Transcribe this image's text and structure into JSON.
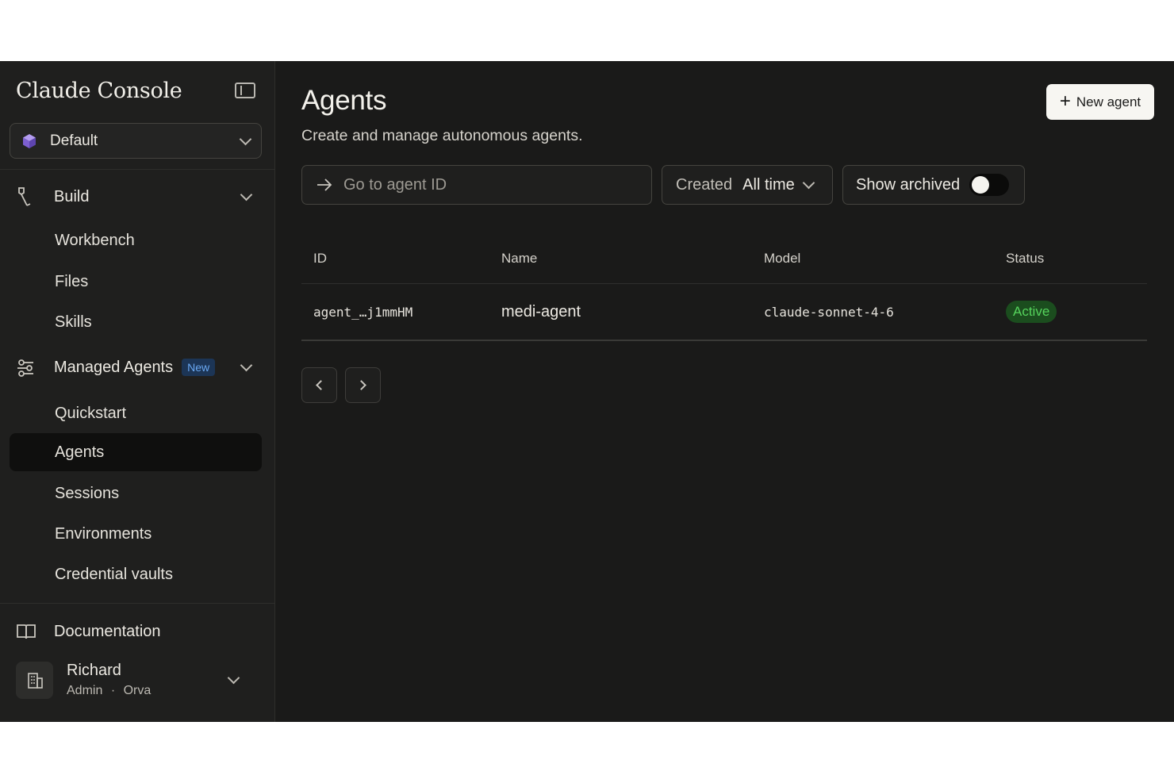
{
  "app": {
    "brand": "Claude Console"
  },
  "workspace": {
    "label": "Default"
  },
  "sidebar": {
    "build": {
      "label": "Build",
      "items": [
        "Workbench",
        "Files",
        "Skills"
      ]
    },
    "managed_agents": {
      "label": "Managed Agents",
      "badge": "New",
      "items": [
        "Quickstart",
        "Agents",
        "Sessions",
        "Environments",
        "Credential vaults"
      ],
      "active": "Agents"
    },
    "documentation": "Documentation",
    "user": {
      "name": "Richard",
      "role": "Admin",
      "org": "Orva",
      "separator": "·"
    }
  },
  "main": {
    "title": "Agents",
    "subtitle": "Create and manage autonomous agents.",
    "new_agent_label": "New agent",
    "search": {
      "placeholder": "Go to agent ID",
      "value": ""
    },
    "filter": {
      "label": "Created",
      "value": "All time"
    },
    "archived": {
      "label": "Show archived",
      "enabled": false
    }
  },
  "table": {
    "columns": [
      "ID",
      "Name",
      "Model",
      "Status"
    ],
    "rows": [
      {
        "id": "agent_…j1mmHM",
        "name": "medi-agent",
        "model": "claude-sonnet-4-6",
        "status": "Active"
      }
    ]
  },
  "colors": {
    "background": "#1a1a19",
    "sidebar": "#1f1f1e",
    "status_active_bg": "#1b4d1e",
    "status_active_text": "#55d35c",
    "new_badge_text": "#6aa8f2",
    "workspace_icon": "#8b6fd8"
  },
  "icons": {
    "sidebar_toggle": "sidebar-toggle-icon",
    "workspace": "cube-icon",
    "build": "build-tool-icon",
    "managed_agents": "sliders-icon",
    "documentation": "book-icon",
    "user": "building-icon",
    "search": "arrow-right-icon"
  }
}
